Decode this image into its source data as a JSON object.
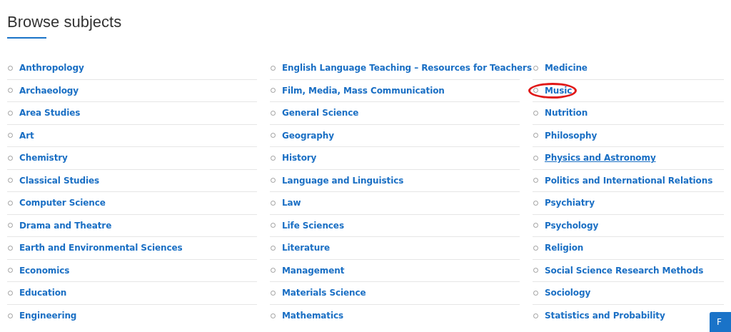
{
  "title": "Browse subjects",
  "columns": [
    {
      "items": [
        {
          "label": "Anthropology",
          "hovered": false,
          "circled": false
        },
        {
          "label": "Archaeology",
          "hovered": false,
          "circled": false
        },
        {
          "label": "Area Studies",
          "hovered": false,
          "circled": false
        },
        {
          "label": "Art",
          "hovered": false,
          "circled": false
        },
        {
          "label": "Chemistry",
          "hovered": false,
          "circled": false
        },
        {
          "label": "Classical Studies",
          "hovered": false,
          "circled": false
        },
        {
          "label": "Computer Science",
          "hovered": false,
          "circled": false
        },
        {
          "label": "Drama and Theatre",
          "hovered": false,
          "circled": false
        },
        {
          "label": "Earth and Environmental Sciences",
          "hovered": false,
          "circled": false
        },
        {
          "label": "Economics",
          "hovered": false,
          "circled": false
        },
        {
          "label": "Education",
          "hovered": false,
          "circled": false
        },
        {
          "label": "Engineering",
          "hovered": false,
          "circled": false
        }
      ]
    },
    {
      "items": [
        {
          "label": "English Language Teaching – Resources for Teachers",
          "hovered": false,
          "circled": false
        },
        {
          "label": "Film, Media, Mass Communication",
          "hovered": false,
          "circled": false
        },
        {
          "label": "General Science",
          "hovered": false,
          "circled": false
        },
        {
          "label": "Geography",
          "hovered": false,
          "circled": false
        },
        {
          "label": "History",
          "hovered": false,
          "circled": false
        },
        {
          "label": "Language and Linguistics",
          "hovered": false,
          "circled": false
        },
        {
          "label": "Law",
          "hovered": false,
          "circled": false
        },
        {
          "label": "Life Sciences",
          "hovered": false,
          "circled": false
        },
        {
          "label": "Literature",
          "hovered": false,
          "circled": false
        },
        {
          "label": "Management",
          "hovered": false,
          "circled": false
        },
        {
          "label": "Materials Science",
          "hovered": false,
          "circled": false
        },
        {
          "label": "Mathematics",
          "hovered": false,
          "circled": false
        }
      ]
    },
    {
      "items": [
        {
          "label": "Medicine",
          "hovered": false,
          "circled": false
        },
        {
          "label": "Music",
          "hovered": false,
          "circled": true
        },
        {
          "label": "Nutrition",
          "hovered": false,
          "circled": false
        },
        {
          "label": "Philosophy",
          "hovered": false,
          "circled": false
        },
        {
          "label": "Physics and Astronomy",
          "hovered": true,
          "circled": false
        },
        {
          "label": "Politics and International Relations",
          "hovered": false,
          "circled": false
        },
        {
          "label": "Psychiatry",
          "hovered": false,
          "circled": false
        },
        {
          "label": "Psychology",
          "hovered": false,
          "circled": false
        },
        {
          "label": "Religion",
          "hovered": false,
          "circled": false
        },
        {
          "label": "Social Science Research Methods",
          "hovered": false,
          "circled": false
        },
        {
          "label": "Sociology",
          "hovered": false,
          "circled": false
        },
        {
          "label": "Statistics and Probability",
          "hovered": false,
          "circled": false
        }
      ]
    }
  ],
  "corner_button": {
    "label": "F"
  }
}
